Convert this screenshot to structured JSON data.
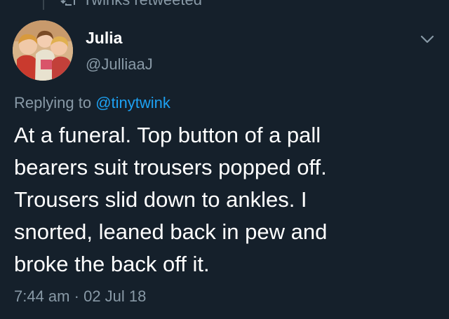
{
  "retweet_context": {
    "text": "Twinks retweeted",
    "icon": "retweet-icon"
  },
  "tweet": {
    "author": {
      "display_name": "Julia",
      "handle": "@JulliaaJ",
      "avatar_icon": "avatar-vintage-illustration"
    },
    "menu_icon": "chevron-down-icon",
    "replying_prefix": "Replying to",
    "replying_to": "@tinytwink",
    "text_lines": [
      "At a funeral.  Top button of a pall",
      "bearers suit trousers popped off.",
      "Trousers slid down to ankles. I",
      "snorted, leaned back in pew and",
      "broke the back off it."
    ],
    "time": "7:44 am",
    "separator": "·",
    "date": "02 Jul 18"
  },
  "colors": {
    "background": "#15202b",
    "primary_text": "#ffffff",
    "secondary_text": "#8899a6",
    "accent": "#1da1f2"
  }
}
